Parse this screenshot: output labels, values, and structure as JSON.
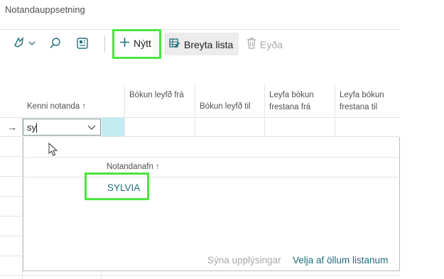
{
  "page": {
    "title": "Notandauppsetning"
  },
  "toolbar": {
    "new_label": "Nýtt",
    "edit_list_label": "Breyta lista",
    "delete_label": "Eyða"
  },
  "columns": [
    {
      "label": "Kenni notanda ↑"
    },
    {
      "label": "Bókun leyfð frá"
    },
    {
      "label": "Bókun leyfð til"
    },
    {
      "label": "Leyfa bókun frestana frá"
    },
    {
      "label": "Leyfa bókun frestana til"
    }
  ],
  "row": {
    "indicator": "→",
    "input_value": "sy"
  },
  "lookup": {
    "column_header": "Notandanafn ↑",
    "items": [
      "SYLVIA"
    ],
    "show_details_label": "Sýna upplýsingar",
    "select_from_full_list_label": "Velja af öllum listanum"
  },
  "colors": {
    "accent": "#1f6e7a",
    "highlight": "#4be53f"
  }
}
